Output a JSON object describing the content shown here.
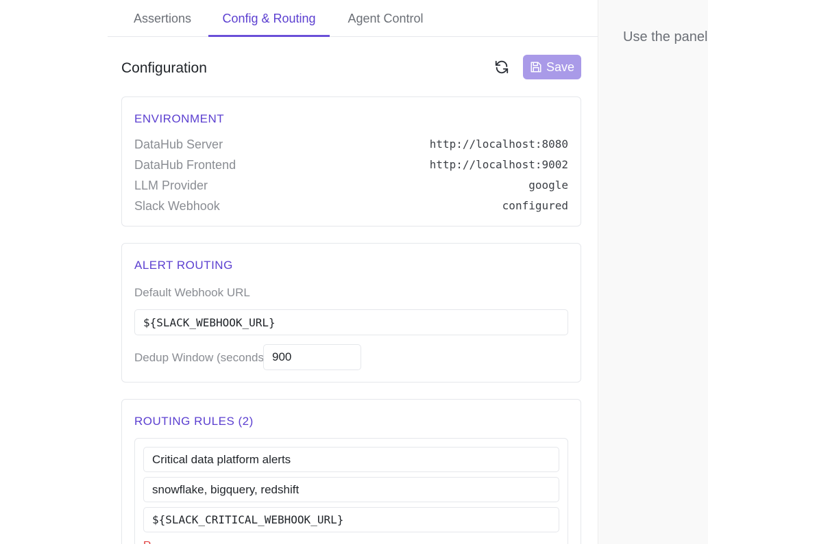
{
  "tabs": [
    {
      "label": "Assertions"
    },
    {
      "label": "Config & Routing"
    },
    {
      "label": "Agent Control"
    }
  ],
  "active_tab": "Config & Routing",
  "config": {
    "title": "Configuration",
    "save_label": "Save"
  },
  "environment": {
    "heading": "ENVIRONMENT",
    "rows": [
      {
        "label": "DataHub Server",
        "value": "http://localhost:8080"
      },
      {
        "label": "DataHub Frontend",
        "value": "http://localhost:9002"
      },
      {
        "label": "LLM Provider",
        "value": "google"
      },
      {
        "label": "Slack Webhook",
        "value": "configured"
      }
    ]
  },
  "alert_routing": {
    "heading": "ALERT ROUTING",
    "webhook_label": "Default Webhook URL",
    "webhook_value": "${SLACK_WEBHOOK_URL}",
    "dedup_label": "Dedup Window (seconds)",
    "dedup_value": "900"
  },
  "routing_rules": {
    "heading": "ROUTING RULES (2)",
    "rules": [
      {
        "name": "Critical data platform alerts",
        "platforms": "snowflake, bigquery, redshift",
        "webhook": "${SLACK_CRITICAL_WEBHOOK_URL}",
        "remove_label": "R"
      }
    ]
  },
  "side_panel": {
    "text": "Use the panel"
  },
  "colors": {
    "accent": "#5b3fd0",
    "save_button": "#a99ae8",
    "danger": "#e03e3e"
  }
}
